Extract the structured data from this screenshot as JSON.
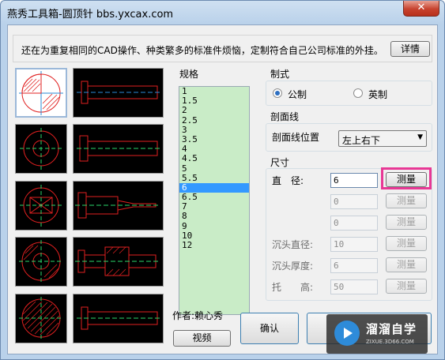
{
  "window": {
    "title": "燕秀工具箱-圆顶针  bbs.yxcax.com",
    "close_label": "✕"
  },
  "notice": {
    "text": "还在为重复相同的CAD操作、种类繁多的标准件烦恼，定制符合自己公司标准的外挂。",
    "detail_button": "详情"
  },
  "spec": {
    "label": "规格",
    "items": [
      "1",
      "1.5",
      "2",
      "2.5",
      "3",
      "3.5",
      "4",
      "4.5",
      "5",
      "5.5",
      "6",
      "6.5",
      "7",
      "8",
      "9",
      "10",
      "12"
    ],
    "selected": "6"
  },
  "system": {
    "label": "制式",
    "metric": "公制",
    "imperial": "英制",
    "selected": "metric"
  },
  "section": {
    "label": "剖面线",
    "position_label": "剖面线位置",
    "position_value": "左上右下"
  },
  "dimensions": {
    "label": "尺寸",
    "diameter_label": "直　径:",
    "diameter_value": "6",
    "field2_value": "0",
    "field3_value": "0",
    "counter_diameter_label": "沉头直径:",
    "counter_diameter_value": "10",
    "counter_thickness_label": "沉头厚度:",
    "counter_thickness_value": "6",
    "support_label": "托　　高:",
    "support_value": "50",
    "measure_label": "测量"
  },
  "footer": {
    "author": "作者:赖心秀",
    "video_button": "视频",
    "confirm_button": "确认"
  },
  "watermark": {
    "name": "溜溜自学",
    "url": "ZIXUE.3D66.COM"
  },
  "colors": {
    "highlight": "#e83895",
    "list_bg": "#c9ecc7",
    "selection": "#3399ff"
  }
}
